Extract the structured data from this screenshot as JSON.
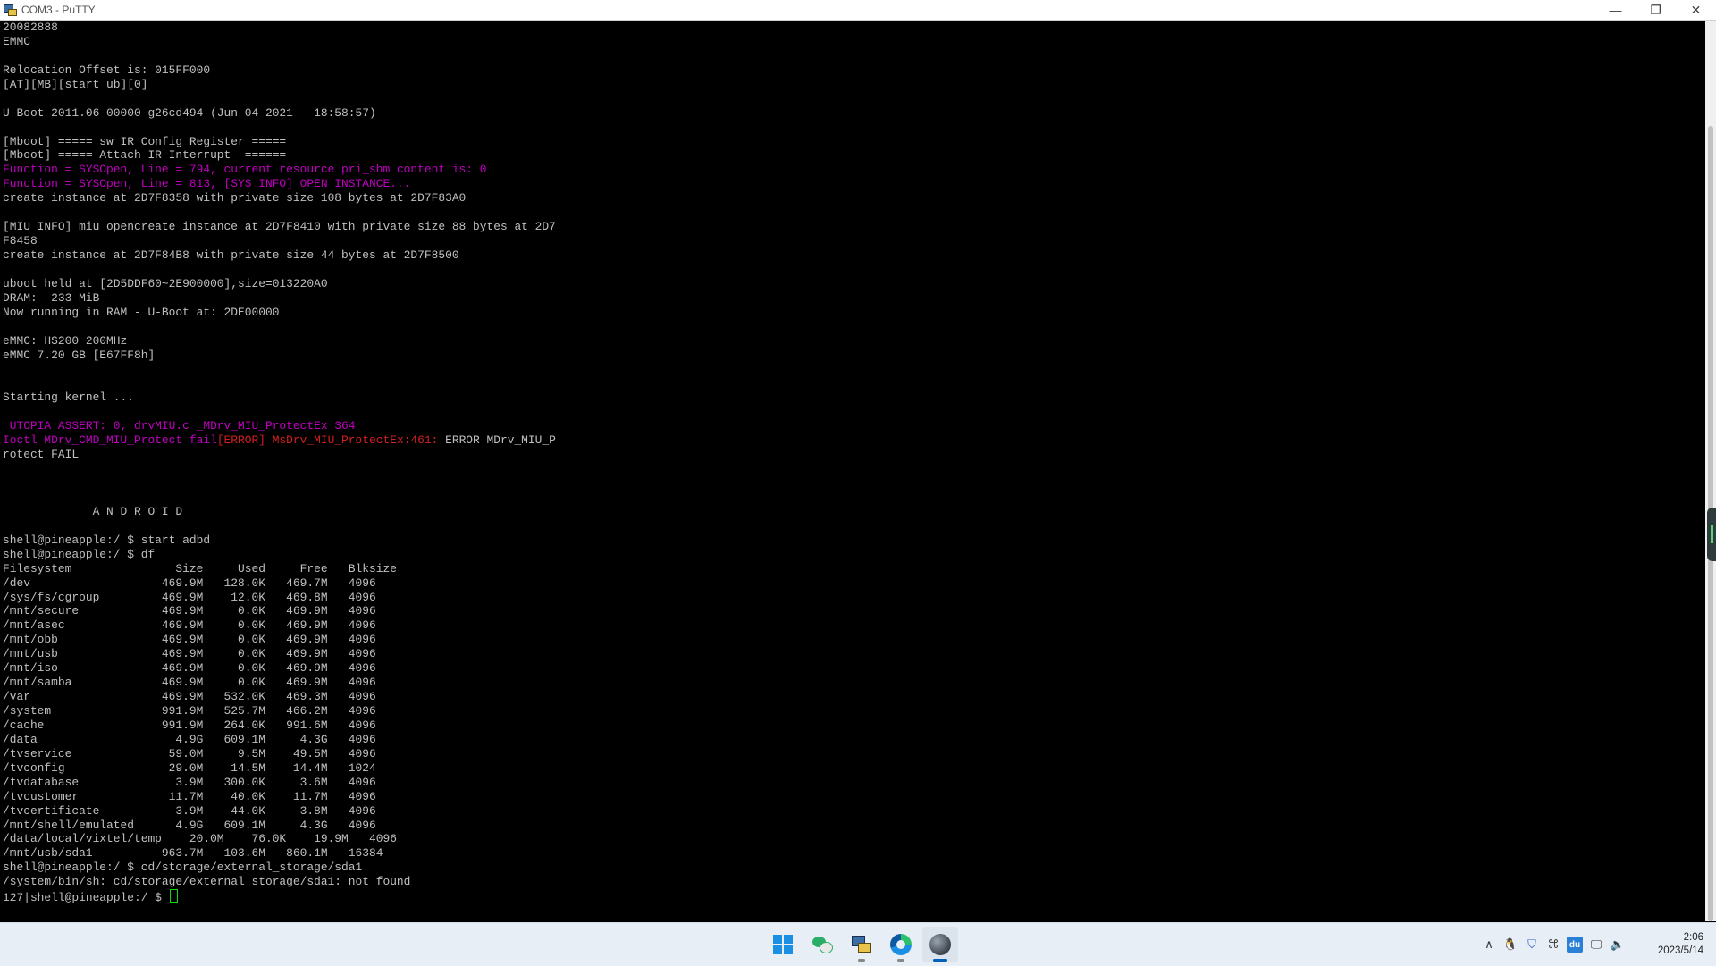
{
  "window": {
    "title": "COM3 - PuTTY",
    "controls": {
      "minimize": "—",
      "restore": "❐",
      "close": "✕"
    }
  },
  "terminal": {
    "lines": [
      {
        "segments": [
          {
            "text": "20082888",
            "color": "white"
          }
        ]
      },
      {
        "segments": [
          {
            "text": "EMMC",
            "color": "white"
          }
        ]
      },
      {
        "segments": [
          {
            "text": "",
            "color": "white"
          }
        ]
      },
      {
        "segments": [
          {
            "text": "Relocation Offset is: 015FF000",
            "color": "white"
          }
        ]
      },
      {
        "segments": [
          {
            "text": "[AT][MB][start ub][0]",
            "color": "white"
          }
        ]
      },
      {
        "segments": [
          {
            "text": "",
            "color": "white"
          }
        ]
      },
      {
        "segments": [
          {
            "text": "U-Boot 2011.06-00000-g26cd494 (Jun 04 2021 - 18:58:57)",
            "color": "white"
          }
        ]
      },
      {
        "segments": [
          {
            "text": "",
            "color": "white"
          }
        ]
      },
      {
        "segments": [
          {
            "text": "[Mboot] ===== sw IR Config Register =====",
            "color": "white"
          }
        ]
      },
      {
        "segments": [
          {
            "text": "[Mboot] ===== Attach IR Interrupt  ======",
            "color": "white"
          }
        ]
      },
      {
        "segments": [
          {
            "text": "Function = SYSOpen, Line = 794, current resource pri_shm content is: 0",
            "color": "magenta"
          }
        ]
      },
      {
        "segments": [
          {
            "text": "Function = SYSOpen, Line = 813, [SYS INFO] OPEN INSTANCE...",
            "color": "magenta"
          }
        ]
      },
      {
        "segments": [
          {
            "text": "create instance at 2D7F8358 with private size 108 bytes at 2D7F83A0",
            "color": "white"
          }
        ]
      },
      {
        "segments": [
          {
            "text": "",
            "color": "white"
          }
        ]
      },
      {
        "segments": [
          {
            "text": "[MIU INFO] miu opencreate instance at 2D7F8410 with private size 88 bytes at 2D7",
            "color": "white"
          }
        ]
      },
      {
        "segments": [
          {
            "text": "F8458",
            "color": "white"
          }
        ]
      },
      {
        "segments": [
          {
            "text": "create instance at 2D7F84B8 with private size 44 bytes at 2D7F8500",
            "color": "white"
          }
        ]
      },
      {
        "segments": [
          {
            "text": "",
            "color": "white"
          }
        ]
      },
      {
        "segments": [
          {
            "text": "uboot held at [2D5DDF60~2E900000],size=013220A0",
            "color": "white"
          }
        ]
      },
      {
        "segments": [
          {
            "text": "DRAM:  233 MiB",
            "color": "white"
          }
        ]
      },
      {
        "segments": [
          {
            "text": "Now running in RAM - U-Boot at: 2DE00000",
            "color": "white"
          }
        ]
      },
      {
        "segments": [
          {
            "text": "",
            "color": "white"
          }
        ]
      },
      {
        "segments": [
          {
            "text": "eMMC: HS200 200MHz",
            "color": "white"
          }
        ]
      },
      {
        "segments": [
          {
            "text": "eMMC 7.20 GB [E67FF8h]",
            "color": "white"
          }
        ]
      },
      {
        "segments": [
          {
            "text": "",
            "color": "white"
          }
        ]
      },
      {
        "segments": [
          {
            "text": "",
            "color": "white"
          }
        ]
      },
      {
        "segments": [
          {
            "text": "Starting kernel ...",
            "color": "white"
          }
        ]
      },
      {
        "segments": [
          {
            "text": "",
            "color": "white"
          }
        ]
      },
      {
        "segments": [
          {
            "text": " UTOPIA ASSERT: 0, drvMIU.c _MDrv_MIU_ProtectEx 364",
            "color": "magenta"
          }
        ]
      },
      {
        "segments": [
          {
            "text": "Ioctl MDrv_CMD_MIU_Protect fail",
            "color": "magenta"
          },
          {
            "text": "[ERROR] MsDrv_MIU_ProtectEx:461:",
            "color": "red"
          },
          {
            "text": " ERROR MDrv_MIU_P",
            "color": "white"
          }
        ]
      },
      {
        "segments": [
          {
            "text": "rotect FAIL",
            "color": "white"
          }
        ]
      },
      {
        "segments": [
          {
            "text": "",
            "color": "white"
          }
        ]
      },
      {
        "segments": [
          {
            "text": "",
            "color": "white"
          }
        ]
      },
      {
        "segments": [
          {
            "text": "",
            "color": "white"
          }
        ]
      },
      {
        "segments": [
          {
            "text": "             A N D R O I D",
            "color": "white"
          }
        ]
      },
      {
        "segments": [
          {
            "text": "",
            "color": "white"
          }
        ]
      },
      {
        "segments": [
          {
            "text": "shell@pineapple:/ $ start adbd",
            "color": "white"
          }
        ]
      },
      {
        "segments": [
          {
            "text": "shell@pineapple:/ $ df",
            "color": "white"
          }
        ]
      },
      {
        "segments": [
          {
            "text": "Filesystem               Size     Used     Free   Blksize",
            "color": "white"
          }
        ]
      },
      {
        "segments": [
          {
            "text": "/dev                   469.9M   128.0K   469.7M   4096",
            "color": "white"
          }
        ]
      },
      {
        "segments": [
          {
            "text": "/sys/fs/cgroup         469.9M    12.0K   469.8M   4096",
            "color": "white"
          }
        ]
      },
      {
        "segments": [
          {
            "text": "/mnt/secure            469.9M     0.0K   469.9M   4096",
            "color": "white"
          }
        ]
      },
      {
        "segments": [
          {
            "text": "/mnt/asec              469.9M     0.0K   469.9M   4096",
            "color": "white"
          }
        ]
      },
      {
        "segments": [
          {
            "text": "/mnt/obb               469.9M     0.0K   469.9M   4096",
            "color": "white"
          }
        ]
      },
      {
        "segments": [
          {
            "text": "/mnt/usb               469.9M     0.0K   469.9M   4096",
            "color": "white"
          }
        ]
      },
      {
        "segments": [
          {
            "text": "/mnt/iso               469.9M     0.0K   469.9M   4096",
            "color": "white"
          }
        ]
      },
      {
        "segments": [
          {
            "text": "/mnt/samba             469.9M     0.0K   469.9M   4096",
            "color": "white"
          }
        ]
      },
      {
        "segments": [
          {
            "text": "/var                   469.9M   532.0K   469.3M   4096",
            "color": "white"
          }
        ]
      },
      {
        "segments": [
          {
            "text": "/system                991.9M   525.7M   466.2M   4096",
            "color": "white"
          }
        ]
      },
      {
        "segments": [
          {
            "text": "/cache                 991.9M   264.0K   991.6M   4096",
            "color": "white"
          }
        ]
      },
      {
        "segments": [
          {
            "text": "/data                    4.9G   609.1M     4.3G   4096",
            "color": "white"
          }
        ]
      },
      {
        "segments": [
          {
            "text": "/tvservice              59.0M     9.5M    49.5M   4096",
            "color": "white"
          }
        ]
      },
      {
        "segments": [
          {
            "text": "/tvconfig               29.0M    14.5M    14.4M   1024",
            "color": "white"
          }
        ]
      },
      {
        "segments": [
          {
            "text": "/tvdatabase              3.9M   300.0K     3.6M   4096",
            "color": "white"
          }
        ]
      },
      {
        "segments": [
          {
            "text": "/tvcustomer             11.7M    40.0K    11.7M   4096",
            "color": "white"
          }
        ]
      },
      {
        "segments": [
          {
            "text": "/tvcertificate           3.9M    44.0K     3.8M   4096",
            "color": "white"
          }
        ]
      },
      {
        "segments": [
          {
            "text": "/mnt/shell/emulated      4.9G   609.1M     4.3G   4096",
            "color": "white"
          }
        ]
      },
      {
        "segments": [
          {
            "text": "/data/local/vixtel/temp    20.0M    76.0K    19.9M   4096",
            "color": "white"
          }
        ]
      },
      {
        "segments": [
          {
            "text": "/mnt/usb/sda1          963.7M   103.6M   860.1M   16384",
            "color": "white"
          }
        ]
      },
      {
        "segments": [
          {
            "text": "shell@pineapple:/ $ cd/storage/external_storage/sda1",
            "color": "white"
          }
        ]
      },
      {
        "segments": [
          {
            "text": "/system/bin/sh: cd/storage/external_storage/sda1: not found",
            "color": "white"
          }
        ]
      },
      {
        "segments": [
          {
            "text": "127|shell@pineapple:/ $ ",
            "color": "white"
          }
        ],
        "cursor": true
      }
    ]
  },
  "colors": {
    "white": "#c0c0c0",
    "magenta": "#c000c0",
    "red": "#d02020",
    "cursor": "#00e000"
  },
  "taskbar": {
    "apps": [
      {
        "name": "start-button",
        "icon": "windows-logo-icon",
        "active": false,
        "running": false
      },
      {
        "name": "taskbar-wechat",
        "icon": "wechat-icon",
        "active": false,
        "running": false
      },
      {
        "name": "taskbar-putty",
        "icon": "putty-icon",
        "active": false,
        "running": true
      },
      {
        "name": "taskbar-edge",
        "icon": "edge-icon",
        "active": false,
        "running": true
      },
      {
        "name": "taskbar-photo-app",
        "icon": "photo-app-icon",
        "active": true,
        "running": true
      }
    ],
    "tray": {
      "chevron": "∧",
      "qq": "🐧",
      "shield": "⛉",
      "network_tool": "⌘",
      "du": "du",
      "monitor": "🖵",
      "volume": "🔈"
    },
    "clock": {
      "time": "2:06",
      "date": "2023/5/14"
    }
  }
}
